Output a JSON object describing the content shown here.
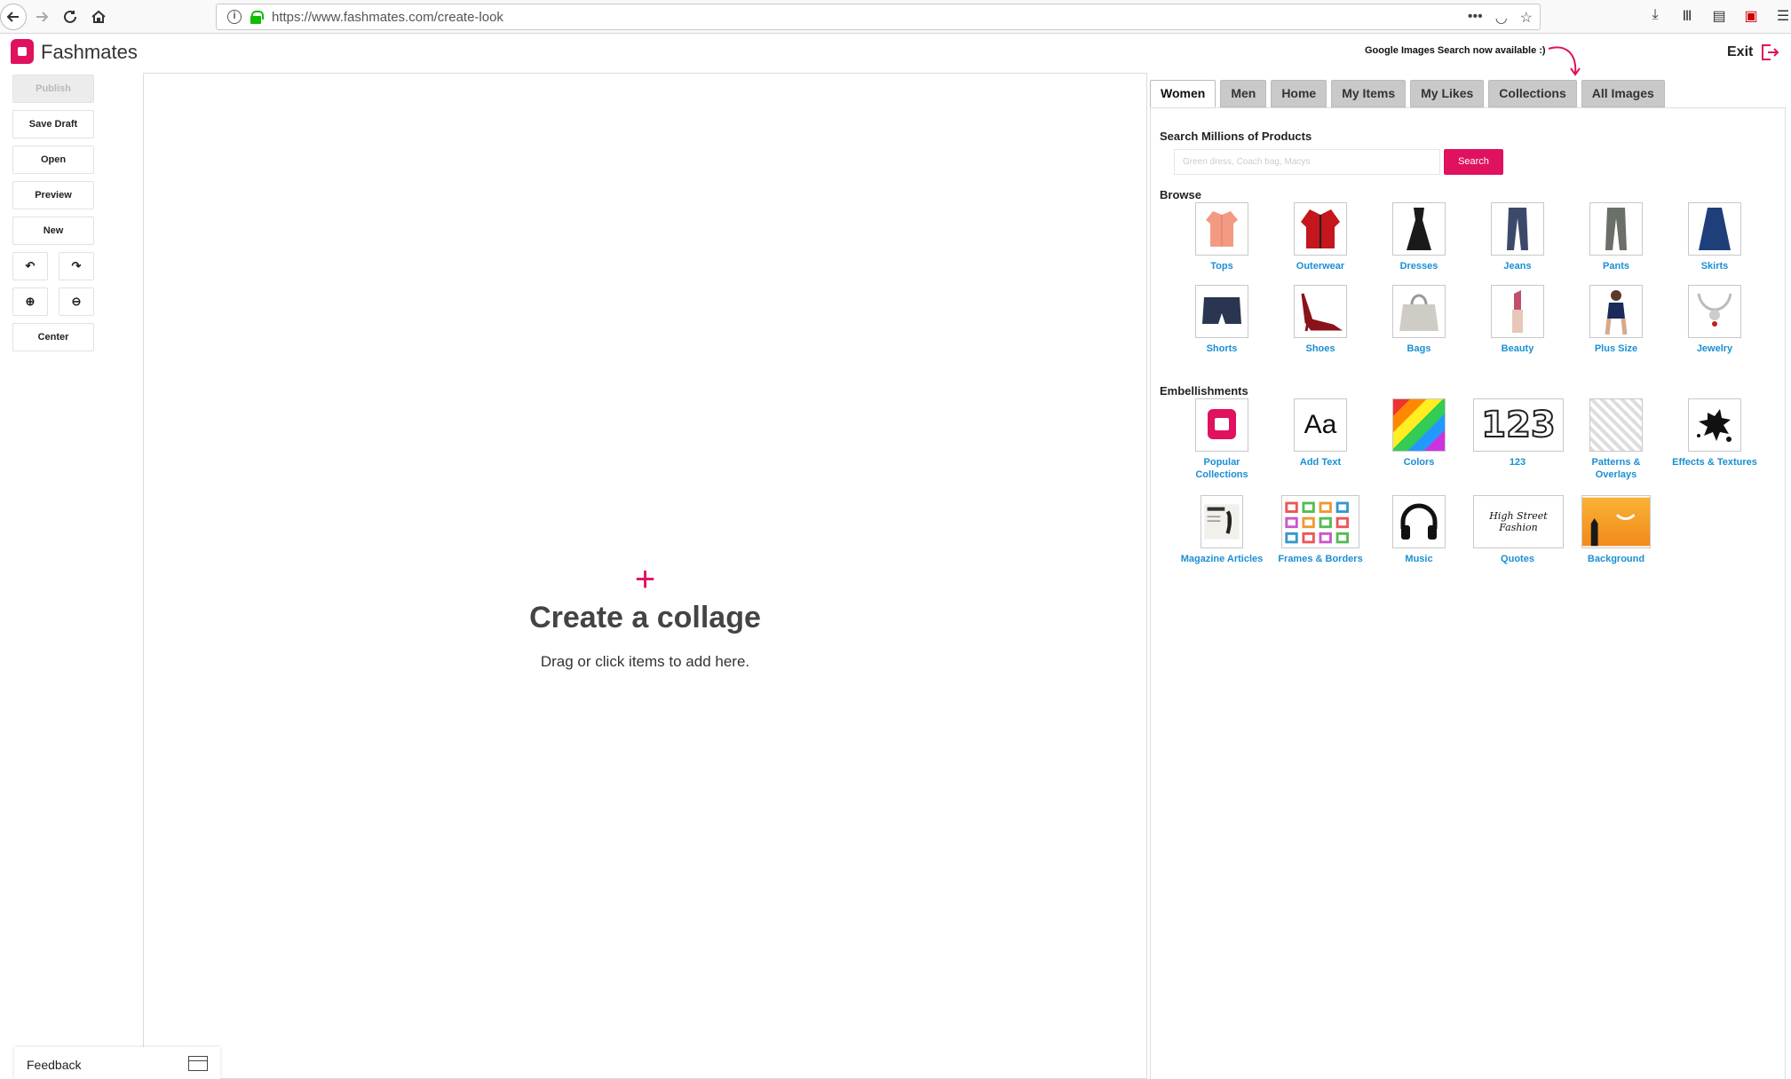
{
  "browser": {
    "url": "https://www.fashmates.com/create-look"
  },
  "header": {
    "logo_text": "Fashmates",
    "google_note": "Google Images Search now available :)",
    "exit_label": "Exit",
    "accent_color": "#e0115f"
  },
  "toolbar": {
    "publish": "Publish",
    "save_draft": "Save Draft",
    "open": "Open",
    "preview": "Preview",
    "new": "New",
    "undo": "↶",
    "redo": "↷",
    "zoom_in": "⊕",
    "zoom_out": "⊖",
    "center": "Center"
  },
  "canvas": {
    "plus": "+",
    "title": "Create a collage",
    "subtitle": "Drag or click items to add here."
  },
  "tabs": [
    "Women",
    "Men",
    "Home",
    "My Items",
    "My Likes",
    "Collections",
    "All Images"
  ],
  "search": {
    "heading": "Search Millions of Products",
    "placeholder": "Green dress, Coach bag, Macys",
    "button": "Search"
  },
  "browse": {
    "heading": "Browse",
    "items": [
      "Tops",
      "Outerwear",
      "Dresses",
      "Jeans",
      "Pants",
      "Skirts",
      "Shorts",
      "Shoes",
      "Bags",
      "Beauty",
      "Plus Size",
      "Jewelry"
    ]
  },
  "embellishments": {
    "heading": "Embellishments",
    "items": [
      "Popular Collections",
      "Add Text",
      "Colors",
      "123",
      "Patterns & Overlays",
      "Effects & Textures",
      "Magazine Articles",
      "Frames & Borders",
      "Music",
      "Quotes",
      "Background"
    ],
    "add_text_glyph": "Aa",
    "number_glyph": "123",
    "quote_glyph": "High Street Fashion"
  },
  "feedback": {
    "label": "Feedback"
  }
}
